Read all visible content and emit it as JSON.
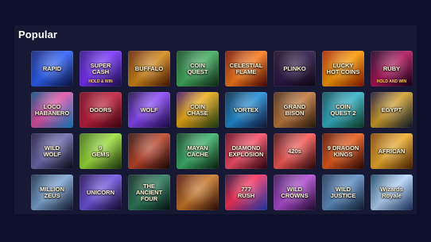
{
  "section": {
    "title": "Popular"
  },
  "games": [
    {
      "title": "RAPID",
      "sub": "",
      "theme": "blue-rapid"
    },
    {
      "title": "SUPER CASH",
      "sub": "HOLD & WIN",
      "theme": "super-cash"
    },
    {
      "title": "BUFFALO",
      "sub": "",
      "theme": "buffalo"
    },
    {
      "title": "COIN\nQUEST",
      "sub": "",
      "theme": "coin-quest"
    },
    {
      "title": "CELESTIAL\nFLAME",
      "sub": "",
      "theme": "celestial"
    },
    {
      "title": "PLINKO",
      "sub": "",
      "theme": "plinko"
    },
    {
      "title": "LUCKY\nHOT COINS",
      "sub": "",
      "theme": "lucky"
    },
    {
      "title": "RUBY",
      "sub": "HOLD AND WIN",
      "theme": "ruby"
    },
    {
      "title": "LOCO\nHABANERO",
      "sub": "",
      "theme": "loco"
    },
    {
      "title": "DOORS",
      "sub": "",
      "theme": "doors"
    },
    {
      "title": "WOLF",
      "sub": "",
      "theme": "wolf"
    },
    {
      "title": "COIN\nCHASE",
      "sub": "",
      "theme": "coin-chase"
    },
    {
      "title": "VORTEX",
      "sub": "",
      "theme": "vortex"
    },
    {
      "title": "GRAND\nBISON",
      "sub": "",
      "theme": "bison"
    },
    {
      "title": "COIN\nQUEST 2",
      "sub": "",
      "theme": "coin-quest-2"
    },
    {
      "title": "EGYPT",
      "sub": "",
      "theme": "egypt"
    },
    {
      "title": "WILD\nWOLF",
      "sub": "",
      "theme": "wild-wolf"
    },
    {
      "title": "9\nGEMS",
      "sub": "",
      "theme": "gems"
    },
    {
      "title": "",
      "sub": "",
      "theme": "red-treasure"
    },
    {
      "title": "MAYAN\nCACHE",
      "sub": "",
      "theme": "mayan"
    },
    {
      "title": "DIAMOND\nEXPLOSION",
      "sub": "",
      "theme": "diamond"
    },
    {
      "title": "420s",
      "sub": "",
      "theme": "420s"
    },
    {
      "title": "9 DRAGON\nKINGS",
      "sub": "",
      "theme": "dragon"
    },
    {
      "title": "AFRICAN",
      "sub": "",
      "theme": "african"
    },
    {
      "title": "MILLION\nZEUS",
      "sub": "",
      "theme": "million-zeus"
    },
    {
      "title": "UNICORN",
      "sub": "",
      "theme": "unicorn"
    },
    {
      "title": "THE\nANCIENT\nFOUR",
      "sub": "",
      "theme": "ancient-four"
    },
    {
      "title": "",
      "sub": "",
      "theme": "pharaoh"
    },
    {
      "title": "777\nRUSH",
      "sub": "",
      "theme": "777"
    },
    {
      "title": "WILD\nCROWNS",
      "sub": "",
      "theme": "wild-crowns"
    },
    {
      "title": "WILD\nJUSTICE",
      "sub": "",
      "theme": "wild-justice"
    },
    {
      "title": "Wizards Royale",
      "sub": "",
      "theme": "wizards"
    }
  ]
}
